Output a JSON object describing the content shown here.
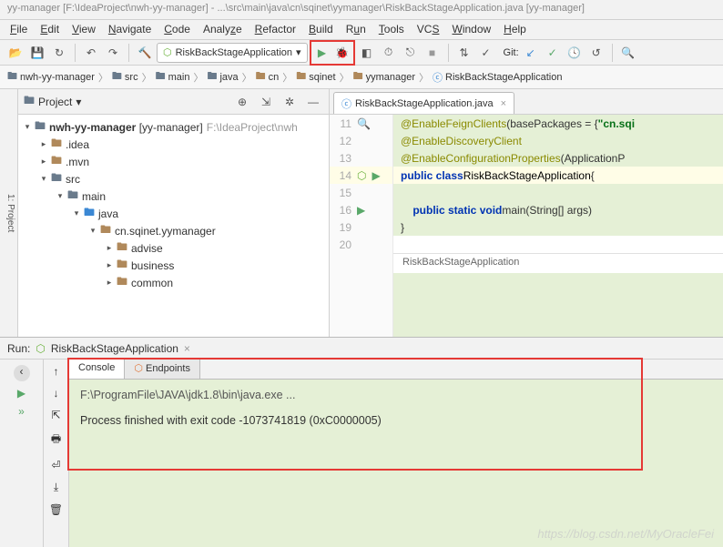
{
  "title_bar": "yy-manager [F:\\IdeaProject\\nwh-yy-manager] - ...\\src\\main\\java\\cn\\sqinet\\yymanager\\RiskBackStageApplication.java [yy-manager]",
  "menu": [
    "File",
    "Edit",
    "View",
    "Navigate",
    "Code",
    "Analyze",
    "Refactor",
    "Build",
    "Run",
    "Tools",
    "VCS",
    "Window",
    "Help"
  ],
  "run_config": "RiskBackStageApplication",
  "git_label": "Git:",
  "breadcrumb": [
    "nwh-yy-manager",
    "src",
    "main",
    "java",
    "cn",
    "sqinet",
    "yymanager",
    "RiskBackStageApplication"
  ],
  "project": {
    "title": "Project",
    "root": "nwh-yy-manager",
    "root_tag": "[yy-manager]",
    "root_path": "F:\\IdeaProject\\nwh",
    "items": [
      ".idea",
      ".mvn",
      "src",
      "main",
      "java",
      "cn.sqinet.yymanager",
      "advise",
      "business",
      "common"
    ]
  },
  "editor": {
    "tab": "RiskBackStageApplication.java",
    "lines": [
      {
        "n": 11,
        "type": "ann",
        "text": "@EnableFeignClients",
        "rest": "(basePackages = { ",
        "str": "\"cn.sqi"
      },
      {
        "n": 12,
        "type": "ann",
        "text": "@EnableDiscoveryClient",
        "rest": ""
      },
      {
        "n": 13,
        "type": "ann",
        "text": "@EnableConfigurationProperties",
        "rest": "(ApplicationP"
      },
      {
        "n": 14,
        "type": "code",
        "html": "public class RiskBackStageApplication {"
      },
      {
        "n": 15,
        "type": "blank"
      },
      {
        "n": 16,
        "type": "code",
        "html": "    public static void main(String[] args)"
      },
      {
        "n": 19,
        "type": "code",
        "html": "}"
      },
      {
        "n": 20,
        "type": "blank"
      }
    ],
    "crumb": "RiskBackStageApplication"
  },
  "run": {
    "label": "Run:",
    "tab": "RiskBackStageApplication",
    "console_tabs": [
      "Console",
      "Endpoints"
    ],
    "out1": "F:\\ProgramFile\\JAVA\\jdk1.8\\bin\\java.exe ...",
    "out2": "Process finished with exit code -1073741819 (0xC0000005)"
  },
  "watermark": "https://blog.csdn.net/MyOracleFei"
}
